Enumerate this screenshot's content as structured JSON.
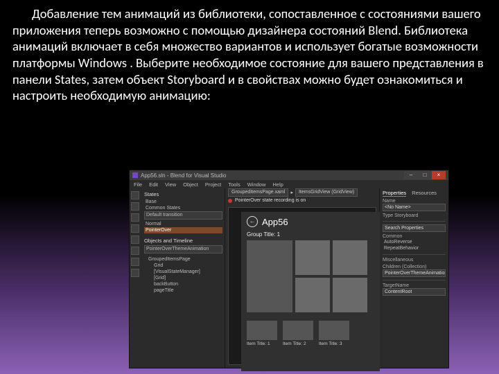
{
  "body_text": "Добавление тем анимаций из библиотеки, сопоставленное с состояниями вашего приложения теперь возможно с помощью дизайнера состояний Blend. Библиотека анимаций включает в себя множество вариантов и использует богатые возможности платформы Windows . Выберите необходимое состояние для вашего представления в панели States, затем объект Storyboard и в свойствах можно будет ознакомиться и настроить необходимую анимацию:",
  "blend": {
    "window_title": "App56.sln - Blend for Visual Studio",
    "win_buttons": {
      "min": "–",
      "max": "□",
      "close": "×"
    },
    "menu": [
      "File",
      "Edit",
      "View",
      "Object",
      "Project",
      "Tools",
      "Window",
      "Help"
    ],
    "left": {
      "states_label": "States",
      "base": "Base",
      "group": "Common States",
      "default_trans": "Default transition",
      "normal": "Normal",
      "pointer": "PointerOver",
      "objects_label": "Objects and Timeline",
      "storyboard": "PointerOverThemeAnimation",
      "tree_root": "GroupedItemsPage",
      "tree_grid": "Grid",
      "tree_item1": "[VisualStateManager]",
      "tree_item2": "[Grid]",
      "tree_item3": "backButton",
      "tree_item4": "pageTitle"
    },
    "center": {
      "crumb1": "GroupedItemsPage.xaml",
      "crumb2": "ItemsGridView (GridView)",
      "recording": "PointerOver state recording is on",
      "page_title": "App56",
      "group_title": "Group Title: 1",
      "item1": "Item Title: 1",
      "item2": "Item Title: 2",
      "item3": "Item Title: 3"
    },
    "right": {
      "tab1": "Properties",
      "tab2": "Resources",
      "name_label": "Name",
      "name_value": "<No Name>",
      "type_label": "Type  Storyboard",
      "search_label": "Search Properties",
      "cat_common": "Common",
      "autoreverse": "AutoReverse",
      "repeat": "RepeatBehavior",
      "cat_misc": "Miscellaneous",
      "children_label": "Children (Collection)",
      "children_value": "PointerOverThemeAnimation",
      "target_label": "TargetName",
      "target_value": "ContentRoot"
    }
  }
}
